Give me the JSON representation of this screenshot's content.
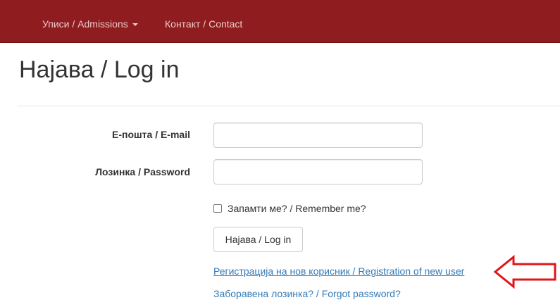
{
  "navbar": {
    "items": [
      {
        "label": "Уписи / Admissions",
        "has_dropdown": true
      },
      {
        "label": "Контакт / Contact",
        "has_dropdown": false
      }
    ],
    "background_color": "#8f1c1f"
  },
  "page": {
    "title": "Најава / Log in"
  },
  "form": {
    "email": {
      "label": "Е-пошта / E-mail",
      "value": "",
      "placeholder": ""
    },
    "password": {
      "label": "Лозинка / Password",
      "value": "",
      "placeholder": ""
    },
    "remember_me": {
      "label": "Запамти ме? / Remember me?",
      "checked": false
    },
    "submit_label": "Најава / Log in"
  },
  "links": {
    "register": "Регистрација на нов корисник / Registration of new user",
    "forgot_password": "Заборавена лозинка? / Forgot password?",
    "link_color": "#337ab7"
  },
  "annotation": {
    "icon": "left-arrow-annotation-icon",
    "color": "#e0141b"
  }
}
